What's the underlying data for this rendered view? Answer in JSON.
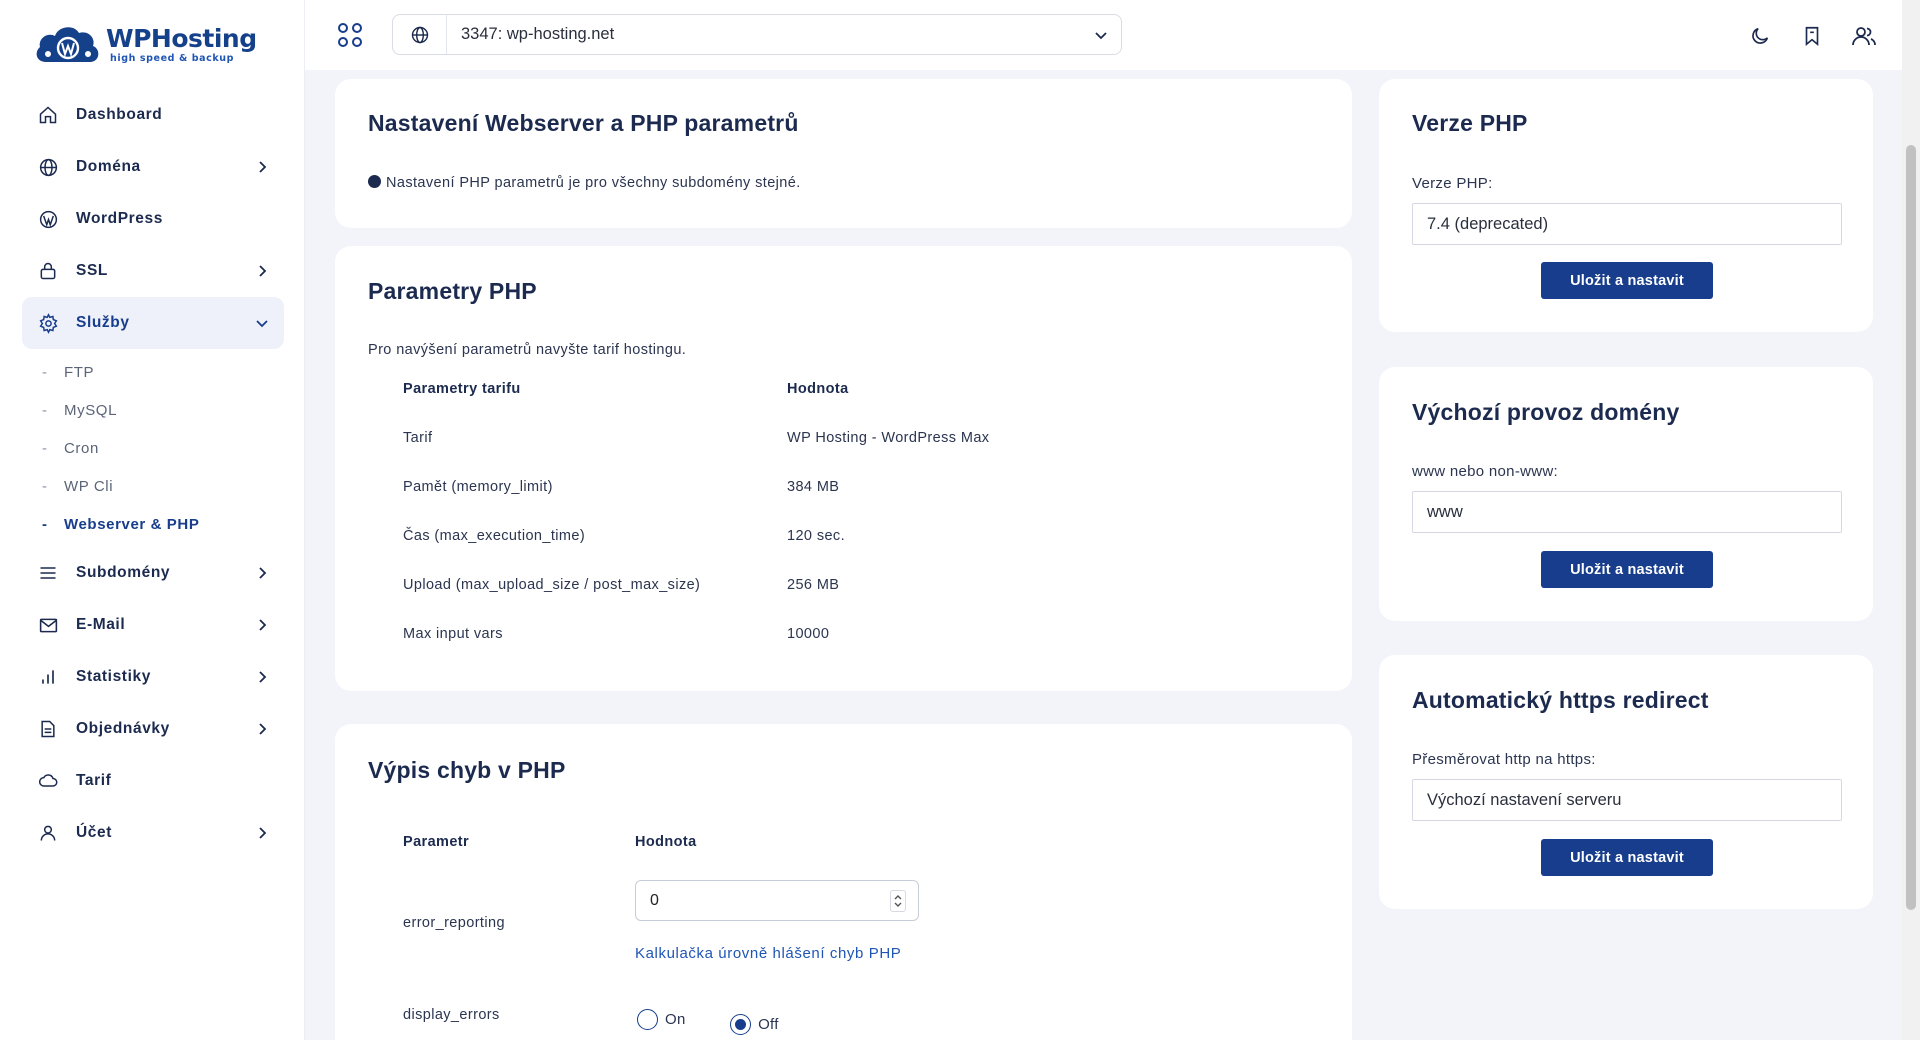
{
  "brand": {
    "name": "WPHosting",
    "tagline": "high speed & backup"
  },
  "sidebar": {
    "items": [
      {
        "label": "Dashboard",
        "icon": "home-icon"
      },
      {
        "label": "Doména",
        "icon": "globe-icon"
      },
      {
        "label": "WordPress",
        "icon": "wordpress-icon"
      },
      {
        "label": "SSL",
        "icon": "lock-icon"
      },
      {
        "label": "Služby",
        "icon": "gear-icon"
      },
      {
        "label": "Subdomény",
        "icon": "menu-icon"
      },
      {
        "label": "E-Mail",
        "icon": "mail-icon"
      },
      {
        "label": "Statistiky",
        "icon": "bar-chart-icon"
      },
      {
        "label": "Objednávky",
        "icon": "document-icon"
      },
      {
        "label": "Tarif",
        "icon": "cloud-icon"
      },
      {
        "label": "Účet",
        "icon": "user-icon"
      }
    ],
    "sub_items": [
      "FTP",
      "MySQL",
      "Cron",
      "WP Cli",
      "Webserver & PHP"
    ]
  },
  "topbar": {
    "domain_value": "3347: wp-hosting.net"
  },
  "webserver_card": {
    "title": "Nastavení Webserver a PHP parametrů",
    "note": "Nastavení PHP parametrů je pro všechny subdomény stejné."
  },
  "params_card": {
    "title": "Parametry PHP",
    "note": "Pro navýšení parametrů navyšte tarif hostingu.",
    "headers": [
      "Parametry tarifu",
      "Hodnota"
    ],
    "rows": [
      [
        "Tarif",
        "WP Hosting - WordPress Max"
      ],
      [
        "Pamět (memory_limit)",
        "384 MB"
      ],
      [
        "Čas (max_execution_time)",
        "120 sec."
      ],
      [
        "Upload (max_upload_size / post_max_size)",
        "256 MB"
      ],
      [
        "Max input vars",
        "10000"
      ]
    ]
  },
  "errors_card": {
    "title": "Výpis chyb v PHP",
    "headers": [
      "Parametr",
      "Hodnota"
    ],
    "error_reporting_label": "error_reporting",
    "error_reporting_value": "0",
    "calculator_link": "Kalkulačka úrovně hlášení chyb PHP",
    "display_errors_label": "display_errors",
    "radio_on": "On",
    "radio_off": "Off",
    "display_errors_selected": "Off"
  },
  "php_version_card": {
    "title": "Verze PHP",
    "field_label": "Verze PHP:",
    "value": "7.4 (deprecated)",
    "button": "Uložit a nastavit"
  },
  "domain_mode_card": {
    "title": "Výchozí provoz domény",
    "field_label": "www nebo non-www:",
    "value": "www",
    "button": "Uložit a nastavit"
  },
  "https_card": {
    "title": "Automatický https redirect",
    "field_label": "Přesměrovat http na https:",
    "value": "Výchozí nastavení serveru",
    "button": "Uložit a nastavit"
  },
  "colors": {
    "primary": "#173d8c",
    "text": "#1b2a4e",
    "background": "#f3f4f9"
  }
}
